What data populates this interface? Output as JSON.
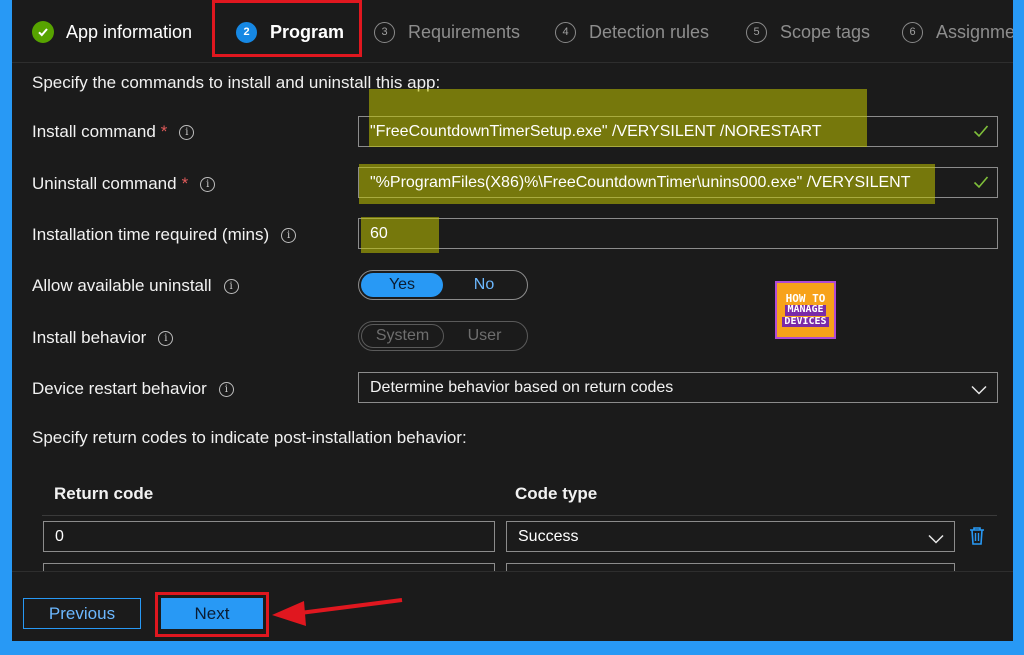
{
  "wizard": {
    "tabs": [
      {
        "num": "",
        "label": "App information",
        "state": "done"
      },
      {
        "num": "2",
        "label": "Program",
        "state": "active"
      },
      {
        "num": "3",
        "label": "Requirements",
        "state": "pending"
      },
      {
        "num": "4",
        "label": "Detection rules",
        "state": "pending"
      },
      {
        "num": "5",
        "label": "Scope tags",
        "state": "pending"
      },
      {
        "num": "6",
        "label": "Assignme",
        "state": "pending"
      }
    ]
  },
  "program": {
    "intro": "Specify the commands to install and uninstall this app:",
    "install_command": {
      "label": "Install command",
      "required": "*",
      "value": "\"FreeCountdownTimerSetup.exe\" /VERYSILENT /NORESTART"
    },
    "uninstall_command": {
      "label": "Uninstall command",
      "required": "*",
      "value": "\"%ProgramFiles(X86)%\\FreeCountdownTimer\\unins000.exe\" /VERYSILENT"
    },
    "install_time": {
      "label": "Installation time required (mins)",
      "value": "60"
    },
    "allow_uninstall": {
      "label": "Allow available uninstall",
      "options": [
        "Yes",
        "No"
      ],
      "selected": "Yes"
    },
    "install_behavior": {
      "label": "Install behavior",
      "options": [
        "System",
        "User"
      ],
      "selected": "System",
      "disabled": true
    },
    "restart_behavior": {
      "label": "Device restart behavior",
      "value": "Determine behavior based on return codes"
    }
  },
  "logo": {
    "line1": "HOW TO",
    "line2": "MANAGE",
    "line3": "DEVICES"
  },
  "return_codes": {
    "intro": "Specify return codes to indicate post-installation behavior:",
    "headers": {
      "code": "Return code",
      "type": "Code type"
    },
    "rows": [
      {
        "code": "0",
        "type": "Success"
      }
    ]
  },
  "footer": {
    "previous": "Previous",
    "next": "Next"
  },
  "colors": {
    "accent": "#2899f5",
    "annotation_red": "#e0171f",
    "highlight": "#c1c400",
    "success_green": "#57a300"
  },
  "icons": {
    "done": "check-circle-icon",
    "info": "info-icon",
    "valid": "checkmark-icon",
    "dropdown": "chevron-down-icon",
    "delete": "trash-icon",
    "annotation": "red-arrow-icon"
  }
}
